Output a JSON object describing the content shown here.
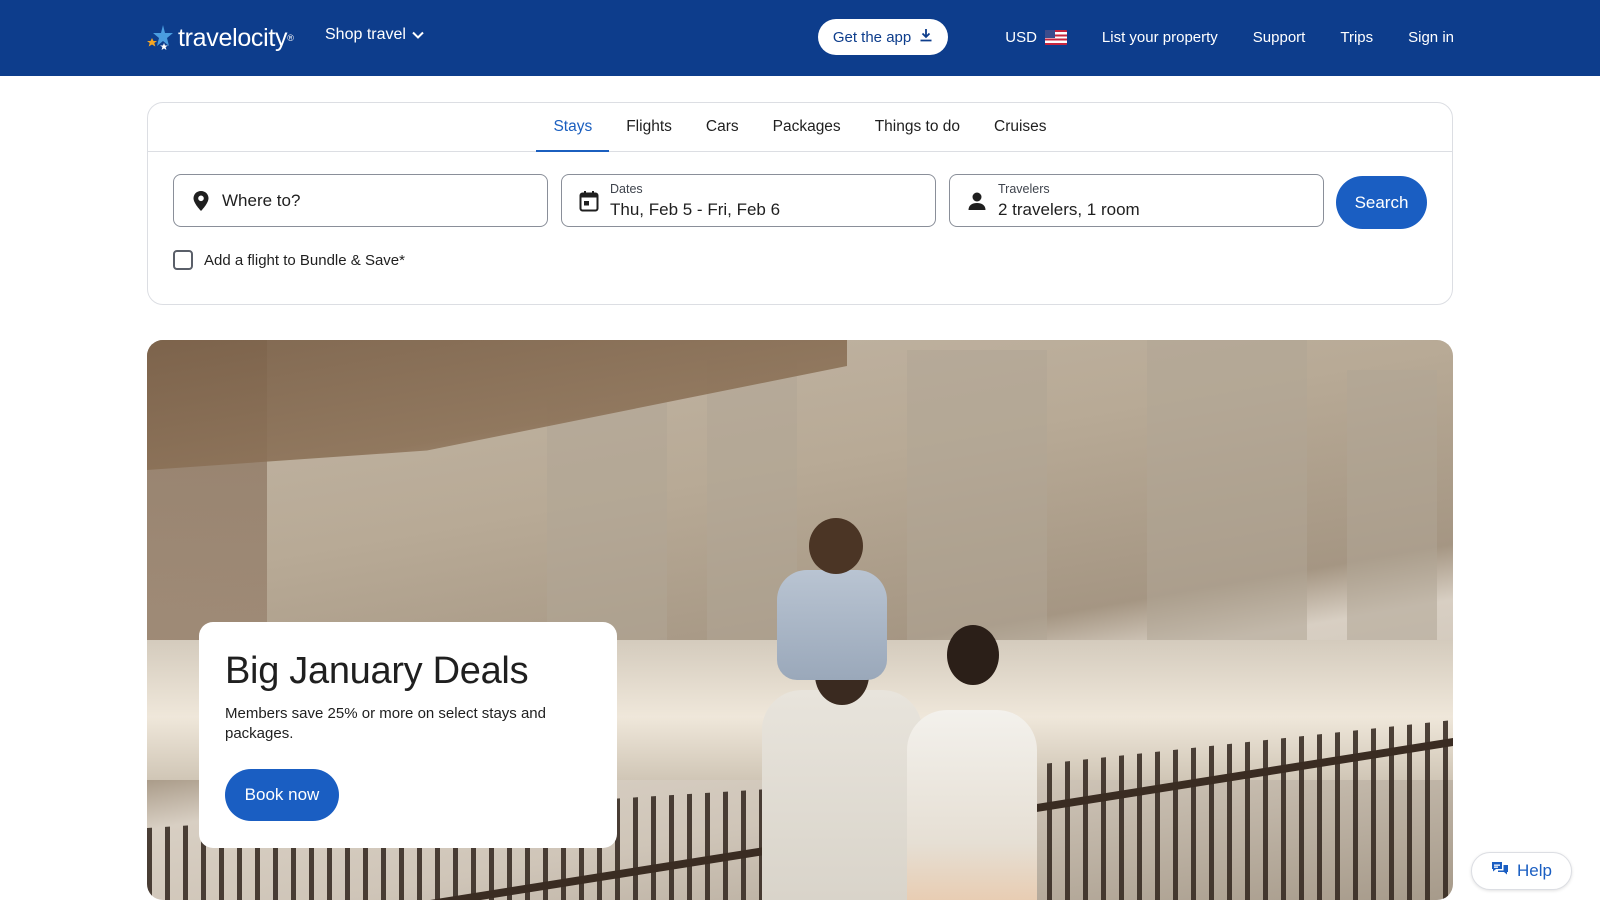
{
  "header": {
    "logo_text": "travelocity",
    "shop_travel_label": "Shop travel",
    "get_app_label": "Get the app",
    "currency_label": "USD",
    "list_property_label": "List your property",
    "support_label": "Support",
    "trips_label": "Trips",
    "sign_in_label": "Sign in",
    "colors": {
      "background": "#0d3d8c",
      "text": "#ffffff"
    }
  },
  "search": {
    "tabs": [
      {
        "label": "Stays",
        "active": true
      },
      {
        "label": "Flights",
        "active": false
      },
      {
        "label": "Cars",
        "active": false
      },
      {
        "label": "Packages",
        "active": false
      },
      {
        "label": "Things to do",
        "active": false
      },
      {
        "label": "Cruises",
        "active": false
      }
    ],
    "destination": {
      "placeholder": "Where to?",
      "icon": "map-pin-icon"
    },
    "dates": {
      "label": "Dates",
      "value": "Thu, Feb 5 - Fri, Feb 6",
      "icon": "calendar-icon"
    },
    "travelers": {
      "label": "Travelers",
      "value": "2 travelers, 1 room",
      "icon": "person-icon"
    },
    "search_label": "Search",
    "bundle_label": "Add a flight to Bundle & Save*",
    "bundle_checked": false,
    "accent_color": "#1a5ec2"
  },
  "hero": {
    "title": "Big January Deals",
    "text": "Members save 25% or more on select stays and packages.",
    "cta_label": "Book now"
  },
  "help": {
    "label": "Help",
    "icon": "chat-icon"
  }
}
